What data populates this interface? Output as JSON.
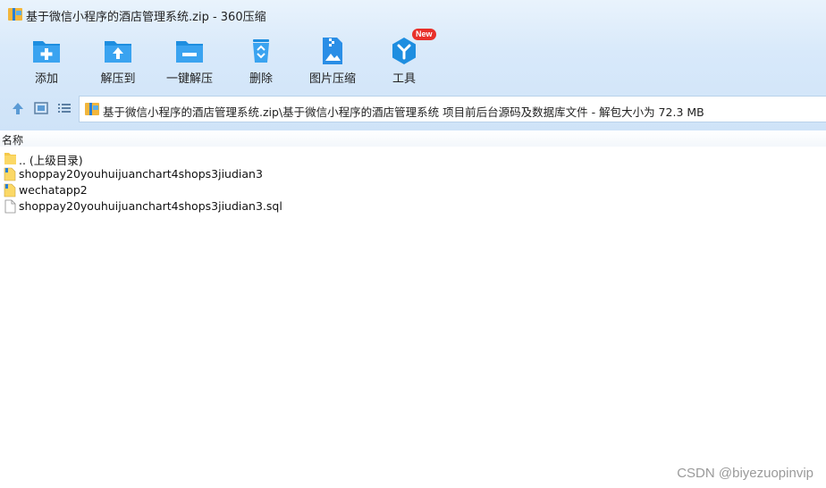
{
  "window": {
    "title": "基于微信小程序的酒店管理系统.zip - 360压缩"
  },
  "toolbar": {
    "items": [
      {
        "label": "添加",
        "icon": "add-folder-icon"
      },
      {
        "label": "解压到",
        "icon": "extract-to-icon"
      },
      {
        "label": "一键解压",
        "icon": "one-click-extract-icon"
      },
      {
        "label": "删除",
        "icon": "recycle-bin-icon"
      },
      {
        "label": "图片压缩",
        "icon": "image-compress-icon"
      },
      {
        "label": "工具",
        "icon": "tools-icon",
        "badge": "New"
      }
    ]
  },
  "nav": {
    "path": "基于微信小程序的酒店管理系统.zip\\基于微信小程序的酒店管理系统 项目前后台源码及数据库文件 - 解包大小为 72.3 MB"
  },
  "list": {
    "column_name": "名称",
    "rows": [
      {
        "name": ".. (上级目录)",
        "type": "folder"
      },
      {
        "name": "shoppay20youhuijuanchart4shops3jiudian3",
        "type": "folder-file"
      },
      {
        "name": "wechatapp2",
        "type": "folder-file"
      },
      {
        "name": "shoppay20youhuijuanchart4shops3jiudian3.sql",
        "type": "file"
      }
    ]
  },
  "watermark": "CSDN @biyezuopinvip",
  "colors": {
    "accent": "#1e8ee0",
    "chrome": "#d8e9fa",
    "badge": "#e8302a"
  }
}
